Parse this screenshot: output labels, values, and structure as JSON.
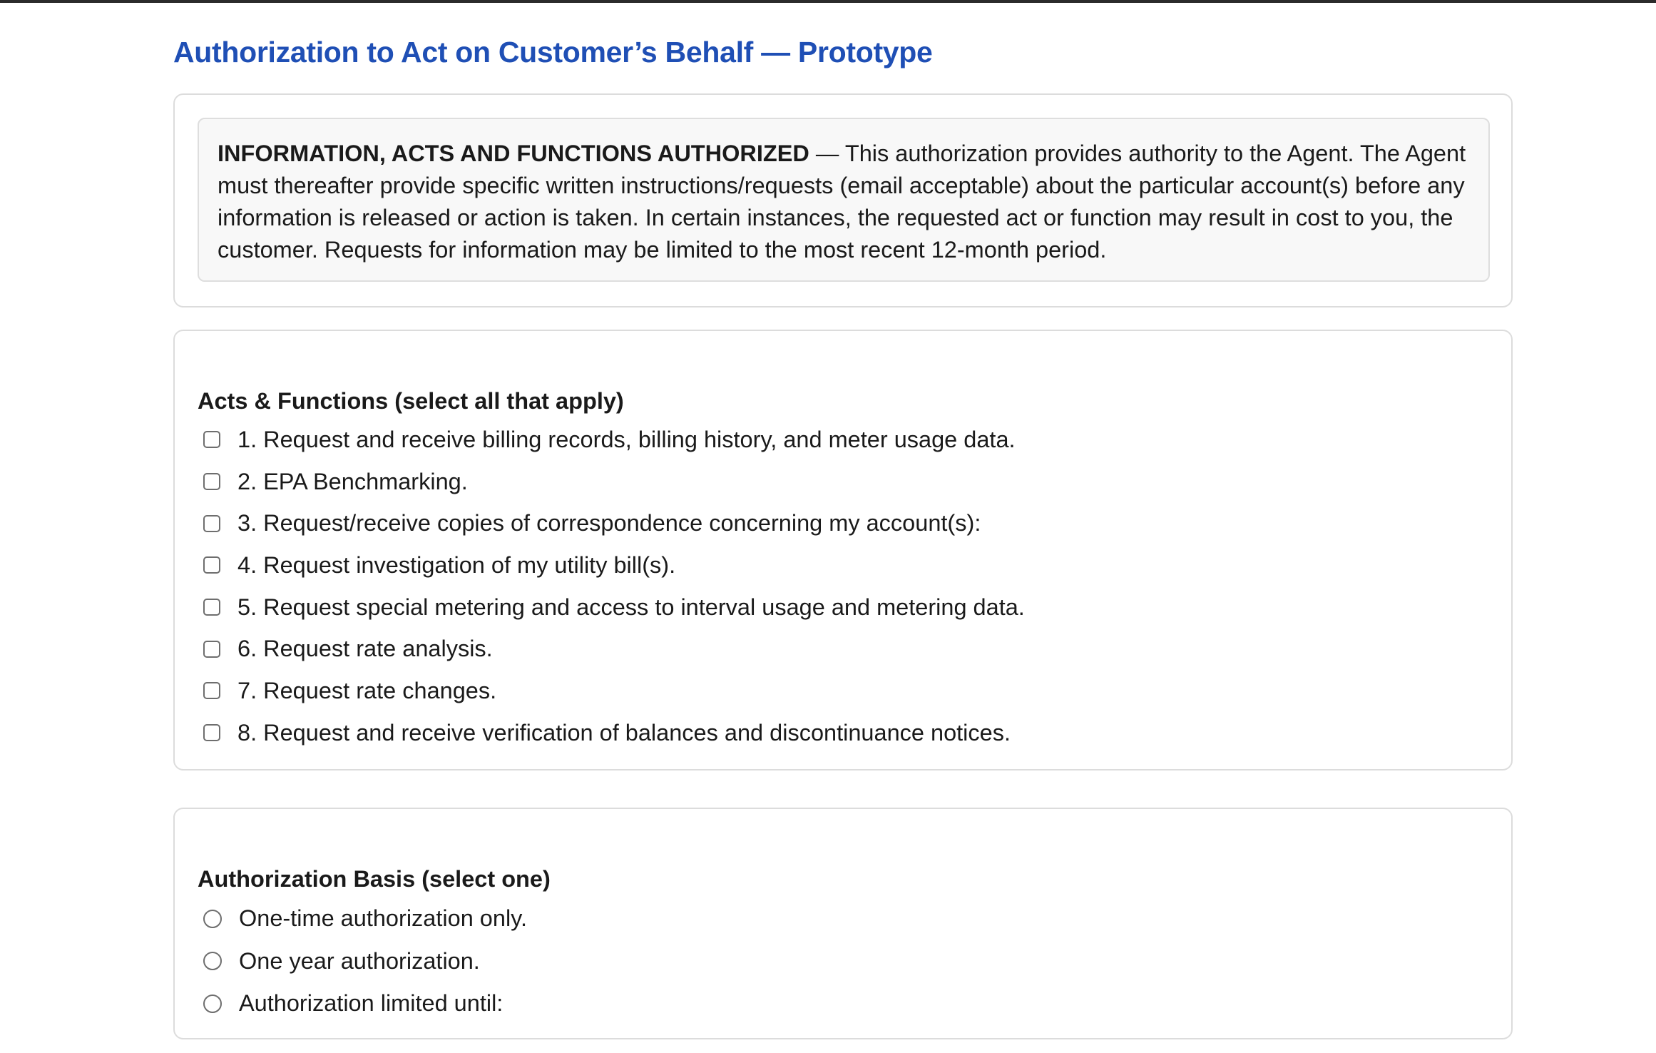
{
  "page": {
    "title": "Authorization to Act on Customer’s Behalf — Prototype"
  },
  "notice": {
    "heading": "INFORMATION, ACTS AND FUNCTIONS AUTHORIZED",
    "body": " — This authorization provides authority to the Agent. The Agent must thereafter provide specific written instructions/requests (email acceptable) about the particular account(s) before any information is released or action is taken. In certain instances, the requested act or function may result in cost to you, the customer. Requests for information may be limited to the most recent 12-month period."
  },
  "acts": {
    "heading": "Acts & Functions (select all that apply)",
    "items": [
      {
        "label": "1. Request and receive billing records, billing history, and meter usage data.",
        "checked": false
      },
      {
        "label": "2. EPA Benchmarking.",
        "checked": false
      },
      {
        "label": "3. Request/receive copies of correspondence concerning my account(s):",
        "checked": false
      },
      {
        "label": "4. Request investigation of my utility bill(s).",
        "checked": false
      },
      {
        "label": "5. Request special metering and access to interval usage and metering data.",
        "checked": false
      },
      {
        "label": "6. Request rate analysis.",
        "checked": false
      },
      {
        "label": "7. Request rate changes.",
        "checked": false
      },
      {
        "label": "8. Request and receive verification of balances and discontinuance notices.",
        "checked": false
      }
    ]
  },
  "basis": {
    "heading": "Authorization Basis (select one)",
    "options": [
      {
        "label": "One-time authorization only.",
        "selected": false
      },
      {
        "label": "One year authorization.",
        "selected": false
      },
      {
        "label": "Authorization limited until:",
        "selected": false
      }
    ]
  },
  "colors": {
    "title": "#1f4fb5",
    "text": "#1a1a1a",
    "card_border": "#dcdcdc",
    "notice_bg": "#f8f8f8"
  }
}
